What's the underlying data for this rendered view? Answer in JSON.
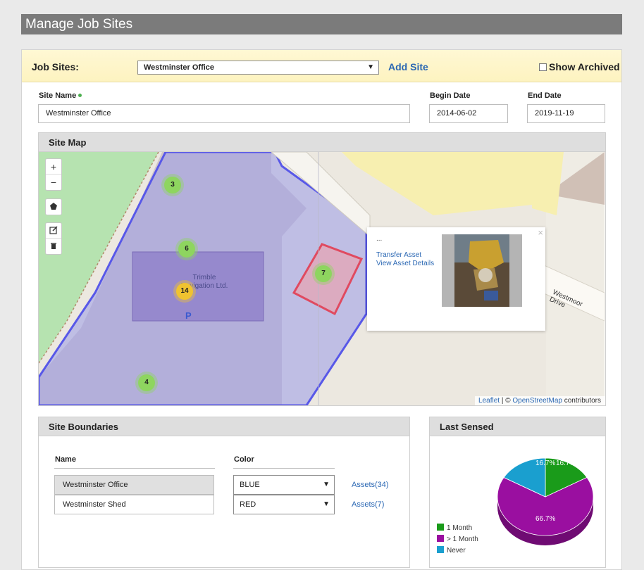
{
  "page": {
    "title": "Manage Job Sites"
  },
  "jobsites": {
    "label": "Job Sites:",
    "selected": "Westminster Office",
    "add_site": "Add Site",
    "show_archived": "Show Archived"
  },
  "form": {
    "site_name_label": "Site Name",
    "site_name_value": "Westminster Office",
    "begin_date_label": "Begin Date",
    "begin_date_value": "2014-06-02",
    "end_date_label": "End Date",
    "end_date_value": "2019-11-19"
  },
  "site_map": {
    "title": "Site Map",
    "controls": {
      "zoom_in": "+",
      "zoom_out": "−"
    },
    "clusters": [
      {
        "count": "3",
        "color": "#8ed55f"
      },
      {
        "count": "6",
        "color": "#8ed55f"
      },
      {
        "count": "14",
        "color": "#f0c330"
      },
      {
        "count": "7",
        "color": "#8ed55f"
      },
      {
        "count": "4",
        "color": "#8ed55f"
      }
    ],
    "map_labels": {
      "street": "Westmoor Drive",
      "building": "Trimble Navigation Ltd.",
      "parking": "P"
    },
    "popup": {
      "dots": "...",
      "transfer": "Transfer Asset",
      "details": "View Asset Details",
      "close": "×"
    },
    "attribution": {
      "leaflet": "Leaflet",
      "sep": " | © ",
      "osm": "OpenStreetMap",
      "suffix": " contributors"
    }
  },
  "site_boundaries": {
    "title": "Site Boundaries",
    "col_name": "Name",
    "col_color": "Color",
    "rows": [
      {
        "name": "Westminster Office",
        "color": "BLUE",
        "assets": "Assets(34)"
      },
      {
        "name": "Westminster Shed",
        "color": "RED",
        "assets": "Assets(7)"
      }
    ]
  },
  "last_sensed": {
    "title": "Last Sensed",
    "chart_data": {
      "type": "pie",
      "categories": [
        "1 Month",
        "> 1 Month",
        "Never"
      ],
      "values": [
        16.7,
        66.7,
        16.7
      ],
      "labels": [
        "16.7%",
        "66.7%",
        "16.7%"
      ],
      "colors": [
        "#1a9b1a",
        "#9a0fa0",
        "#1a9fcf"
      ],
      "legend": "bottom-left"
    }
  }
}
